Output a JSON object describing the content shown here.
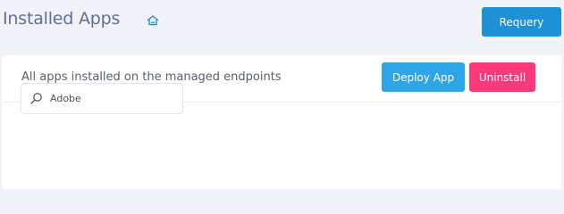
{
  "header": {
    "title": "Installed Apps",
    "home_icon": "home-icon",
    "requery_label": "Requery"
  },
  "panel": {
    "subtitle": "All apps installed on the managed endpoints",
    "deploy_label": "Deploy App",
    "uninstall_label": "Uninstall"
  },
  "search": {
    "icon": "search-icon",
    "value": "Adobe",
    "placeholder": ""
  },
  "colors": {
    "background": "#f2f3f8",
    "title": "#646c9a",
    "requery": "#1e90d6",
    "deploy": "#2ea5e8",
    "uninstall": "#fd397a"
  }
}
